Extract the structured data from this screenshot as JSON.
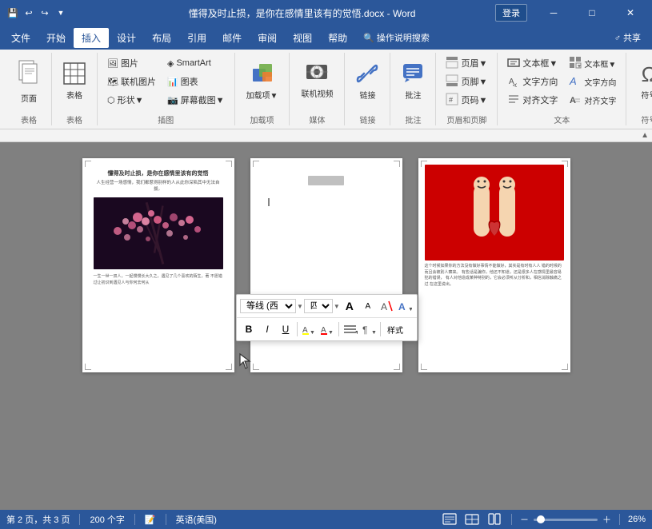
{
  "titleBar": {
    "title": "懂得及时止损，是你在感情里该有的觉悟.docx - Word",
    "appName": "Word",
    "loginLabel": "登录",
    "saveIcon": "💾",
    "undoIcon": "↩",
    "redoIcon": "↪",
    "minimizeLabel": "─",
    "maximizeLabel": "□",
    "closeLabel": "✕"
  },
  "menuBar": {
    "items": [
      {
        "label": "文件",
        "active": false
      },
      {
        "label": "开始",
        "active": false
      },
      {
        "label": "插入",
        "active": true
      },
      {
        "label": "设计",
        "active": false
      },
      {
        "label": "布局",
        "active": false
      },
      {
        "label": "引用",
        "active": false
      },
      {
        "label": "邮件",
        "active": false
      },
      {
        "label": "审阅",
        "active": false
      },
      {
        "label": "视图",
        "active": false
      },
      {
        "label": "帮助",
        "active": false
      },
      {
        "label": "🔍 操作说明搜索",
        "active": false
      }
    ],
    "shareLabel": "♂ 共享"
  },
  "ribbon": {
    "groups": [
      {
        "name": "pages",
        "label": "表格",
        "items": [
          {
            "type": "large",
            "icon": "📄",
            "label": "页面",
            "id": "pages-btn"
          }
        ]
      },
      {
        "name": "table",
        "label": "表格",
        "items": [
          {
            "type": "large",
            "icon": "⊞",
            "label": "表格",
            "id": "table-btn"
          }
        ]
      },
      {
        "name": "illustration",
        "label": "插图",
        "items": [
          {
            "type": "small",
            "icon": "🖼",
            "label": "图片"
          },
          {
            "type": "small",
            "icon": "◈",
            "label": "SmartArt"
          },
          {
            "type": "small",
            "icon": "🗺",
            "label": "联机图片"
          },
          {
            "type": "small",
            "icon": "📊",
            "label": "图表"
          },
          {
            "type": "small",
            "icon": "⬡",
            "label": "形状▼"
          },
          {
            "type": "small",
            "icon": "📷",
            "label": "屏幕截图▼"
          }
        ]
      },
      {
        "name": "addins",
        "label": "加载项",
        "items": [
          {
            "type": "large",
            "icon": "🧩",
            "label": "加载项▼"
          }
        ]
      },
      {
        "name": "media",
        "label": "媒体",
        "items": [
          {
            "type": "large",
            "icon": "🌐",
            "label": "联机视频"
          }
        ]
      },
      {
        "name": "links",
        "label": "链接",
        "items": [
          {
            "type": "large",
            "icon": "🔗",
            "label": "链接"
          }
        ]
      },
      {
        "name": "comments",
        "label": "批注",
        "items": [
          {
            "type": "large",
            "icon": "💬",
            "label": "批注"
          }
        ]
      },
      {
        "name": "headerfooter",
        "label": "页眉和页脚",
        "items": [
          {
            "label": "页眉▼"
          },
          {
            "label": "页脚▼"
          },
          {
            "label": "页码▼"
          }
        ]
      },
      {
        "name": "text",
        "label": "文本",
        "items": [
          {
            "label": "文本框▼"
          },
          {
            "label": "文字方向"
          },
          {
            "label": "对齐文字"
          }
        ]
      },
      {
        "name": "symbols",
        "label": "符号",
        "items": [
          {
            "type": "large",
            "icon": "Ω",
            "label": "符号"
          }
        ]
      }
    ]
  },
  "floatToolbar": {
    "row1": {
      "fontFamily": "等线 (西",
      "fontFamilyArrow": "▼",
      "fontSize": "四号",
      "fontSizeArrow": "▼",
      "growBtn": "A",
      "shrinkBtn": "A",
      "formatClearBtn": "A",
      "textEffectsBtn": "A▼"
    },
    "row2": {
      "boldBtn": "B",
      "italicBtn": "I",
      "underlineBtn": "U",
      "highlightBtn": "A▼",
      "colorBtn": "A▼",
      "listBtn": "≡▼",
      "paraBtn": "¶▼",
      "styleBtn": "样式"
    }
  },
  "pages": {
    "page1": {
      "title": "懂得及时止损，是你在感情里该有的觉悟",
      "subtitle": "人生经营一场感情，我们都惹得别样的人从此你深陷其中无法自拔。",
      "bodyText": "一生一世一双人，一起慢慢长大久之，遇见了几个喜欢的陌生，著\n不愿错过让初识到遇见人与你何去何从"
    },
    "page2": {
      "empty": true
    },
    "page3": {
      "bodyText": "这个时候如果你的方法没有做好事情不能做好，其实是有时有人人\n错的时候的而且会被别人察来。\n有些话是骗你，他还不知道，还是很多人在感情里最容易犯的错误，\n有人对他造成某种特别的，它会必须听从分析和，相信消除触痛之过\n在这里说出。"
    }
  },
  "statusBar": {
    "page": "第 2 页，共 3 页",
    "wordCount": "200 个字",
    "proofingIcon": "📝",
    "language": "英语(美国)",
    "viewPrint": "▤",
    "viewWeb": "🌐",
    "viewRead": "📖",
    "zoomOut": "－",
    "zoomIn": "＋",
    "zoomLevel": "26%"
  }
}
